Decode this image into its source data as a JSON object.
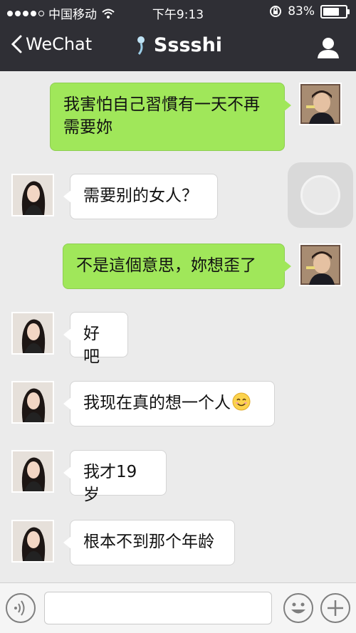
{
  "status_bar": {
    "carrier": "中国移动",
    "time": "下午9:13",
    "battery": "83%",
    "battery_level": 0.83
  },
  "nav": {
    "back_label": "WeChat",
    "title": "Sssshi"
  },
  "messages": [
    {
      "sender": "me",
      "text": "我害怕自己習慣有一天不再需要妳"
    },
    {
      "sender": "them",
      "text": "需要别的女人？"
    },
    {
      "sender": "me",
      "text": "不是這個意思，妳想歪了"
    },
    {
      "sender": "them",
      "text": "好吧"
    },
    {
      "sender": "them",
      "text": "我现在真的想一个人",
      "emoji": "smiley"
    },
    {
      "sender": "them",
      "text": "我才19岁"
    },
    {
      "sender": "them",
      "text": "根本不到那个年龄"
    }
  ],
  "input": {
    "voice_icon": "voice-icon",
    "emoji_icon": "emoji-icon",
    "plus_icon": "plus-icon",
    "value": ""
  },
  "colors": {
    "header_bg": "#2f2f35",
    "chat_bg": "#ebebeb",
    "my_bubble": "#a0e75a",
    "their_bubble": "#ffffff"
  }
}
